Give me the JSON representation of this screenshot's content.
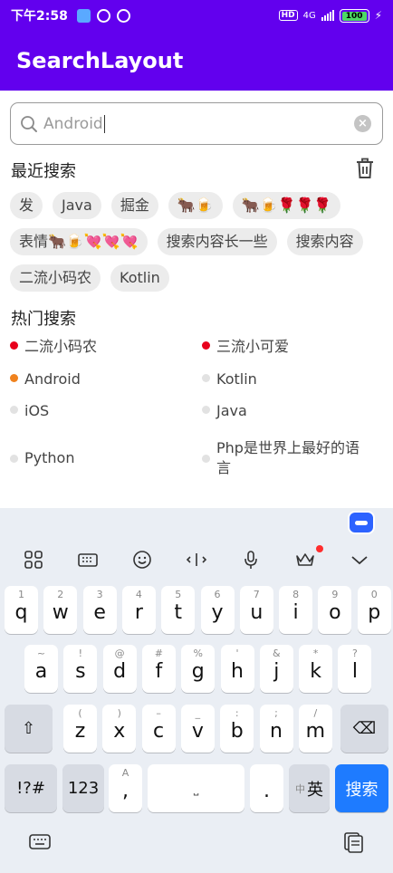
{
  "status": {
    "time": "下午2:58",
    "net": "4G",
    "battery": "100"
  },
  "app": {
    "title": "SearchLayout"
  },
  "search": {
    "value": "Android"
  },
  "recent": {
    "title": "最近搜索",
    "chips": [
      "发",
      "Java",
      "掘金",
      "🐂🍺",
      "🐂🍺🌹🌹🌹",
      "表情🐂🍺💘💘💘",
      "搜索内容长一些",
      "搜索内容",
      "二流小码农",
      "Kotlin"
    ]
  },
  "hot": {
    "title": "热门搜索",
    "rows": [
      [
        {
          "label": "二流小码农",
          "color": "#e8001c"
        },
        {
          "label": "三流小可爱",
          "color": "#e8001c"
        }
      ],
      [
        {
          "label": "Android",
          "color": "#f0821e"
        },
        {
          "label": "Kotlin",
          "color": "#e2e2e2"
        }
      ],
      [
        {
          "label": "iOS",
          "color": "#e2e2e2"
        },
        {
          "label": "Java",
          "color": "#e2e2e2"
        }
      ],
      [
        {
          "label": "Python",
          "color": "#e2e2e2"
        },
        {
          "label": "Php是世界上最好的语言",
          "color": "#e2e2e2"
        }
      ]
    ]
  },
  "keyboard": {
    "row1": [
      {
        "k": "q",
        "h": "1"
      },
      {
        "k": "w",
        "h": "2"
      },
      {
        "k": "e",
        "h": "3"
      },
      {
        "k": "r",
        "h": "4"
      },
      {
        "k": "t",
        "h": "5"
      },
      {
        "k": "y",
        "h": "6"
      },
      {
        "k": "u",
        "h": "7"
      },
      {
        "k": "i",
        "h": "8"
      },
      {
        "k": "o",
        "h": "9"
      },
      {
        "k": "p",
        "h": "0"
      }
    ],
    "row2": [
      {
        "k": "a",
        "h": "~"
      },
      {
        "k": "s",
        "h": "!"
      },
      {
        "k": "d",
        "h": "@"
      },
      {
        "k": "f",
        "h": "#"
      },
      {
        "k": "g",
        "h": "%"
      },
      {
        "k": "h",
        "h": "'"
      },
      {
        "k": "j",
        "h": "&"
      },
      {
        "k": "k",
        "h": "*"
      },
      {
        "k": "l",
        "h": "?"
      }
    ],
    "row3": [
      {
        "k": "z",
        "h": "("
      },
      {
        "k": "x",
        "h": ")"
      },
      {
        "k": "c",
        "h": "–"
      },
      {
        "k": "v",
        "h": "_"
      },
      {
        "k": "b",
        "h": ":"
      },
      {
        "k": "n",
        "h": ";"
      },
      {
        "k": "m",
        "h": "/"
      }
    ],
    "symbols_label": "!?#",
    "numbers_label": "123",
    "comma": ",",
    "period": ".",
    "lang_small": "中",
    "lang_main": "英",
    "search_label": "搜索"
  }
}
